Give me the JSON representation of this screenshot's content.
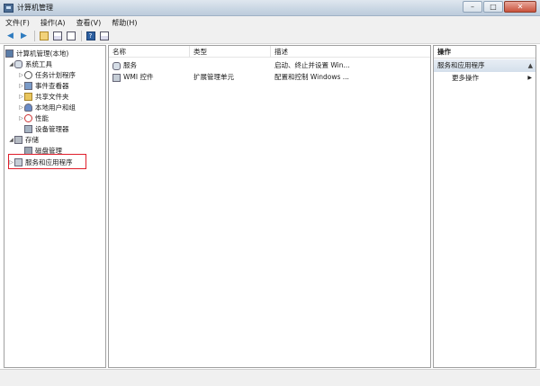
{
  "window": {
    "title": "计算机管理"
  },
  "menu": [
    "文件(F)",
    "操作(A)",
    "查看(V)",
    "帮助(H)"
  ],
  "tree": {
    "root": "计算机管理(本地)",
    "system_tools": "系统工具",
    "task_scheduler": "任务计划程序",
    "event_viewer": "事件查看器",
    "shared_folders": "共享文件夹",
    "local_users": "本地用户和组",
    "performance": "性能",
    "device_manager": "设备管理器",
    "storage": "存储",
    "disk_management": "磁盘管理",
    "services_apps": "服务和应用程序"
  },
  "list": {
    "headers": {
      "name": "名称",
      "type": "类型",
      "desc": "描述"
    },
    "rows": [
      {
        "name": "服务",
        "type": "",
        "desc": "启动、终止并设置 Win..."
      },
      {
        "name": "WMI 控件",
        "type": "扩展管理单元",
        "desc": "配置和控制 Windows ..."
      }
    ]
  },
  "actions": {
    "header": "操作",
    "section": "服务和应用程序",
    "more": "更多操作"
  }
}
